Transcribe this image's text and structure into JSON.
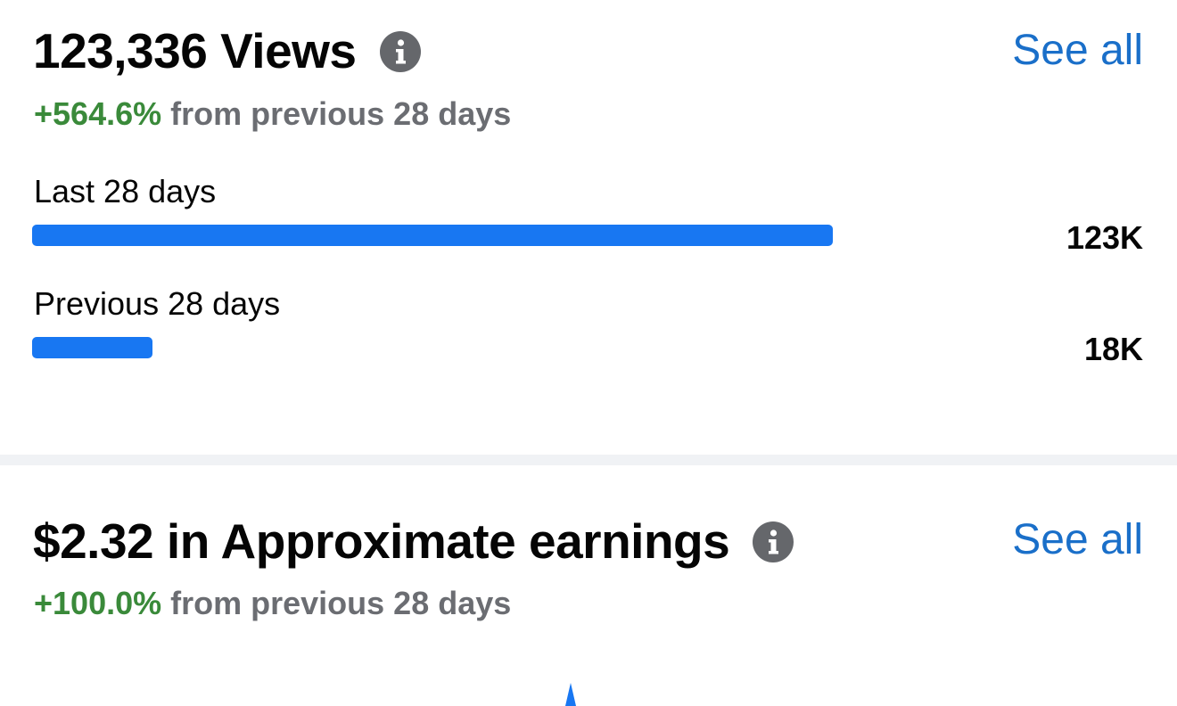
{
  "views": {
    "headline": "123,336 Views",
    "see_all": "See all",
    "delta_pct": "+564.6%",
    "delta_text": "from previous 28 days",
    "comparisons": [
      {
        "label": "Last 28 days",
        "value": "123K",
        "fraction": 1.0
      },
      {
        "label": "Previous 28 days",
        "value": "18K",
        "fraction": 0.15
      }
    ]
  },
  "earnings": {
    "headline": "$2.32 in Approximate earnings",
    "see_all": "See all",
    "delta_pct": "+100.0%",
    "delta_text": "from previous 28 days"
  },
  "icons": {
    "info": "info-icon"
  },
  "colors": {
    "bar": "#1877f2",
    "positive": "#3a8a3a",
    "link": "#1a6fc9",
    "muted": "#6b6d72"
  }
}
